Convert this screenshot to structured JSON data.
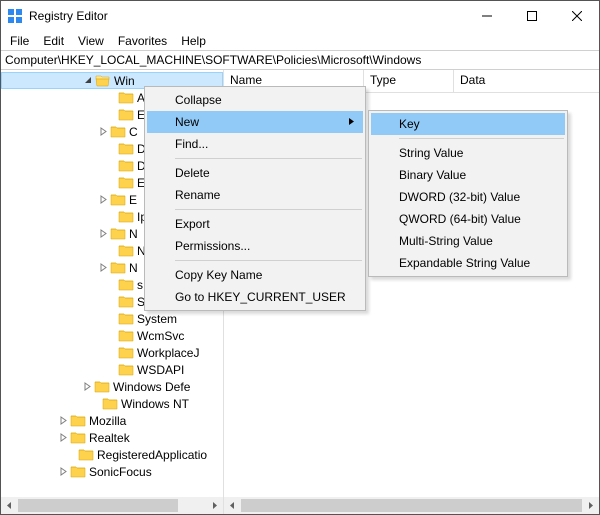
{
  "window": {
    "title": "Registry Editor"
  },
  "menubar": {
    "items": [
      "File",
      "Edit",
      "View",
      "Favorites",
      "Help"
    ]
  },
  "addressbar": {
    "path": "Computer\\HKEY_LOCAL_MACHINE\\SOFTWARE\\Policies\\Microsoft\\Windows"
  },
  "columns": {
    "name": "Name",
    "type": "Type",
    "data": "Data"
  },
  "tree": {
    "items": [
      {
        "indent": 80,
        "exp": "open",
        "label": "Win",
        "selected": true
      },
      {
        "indent": 104,
        "exp": "none",
        "label": "A"
      },
      {
        "indent": 104,
        "exp": "none",
        "label": "E"
      },
      {
        "indent": 96,
        "exp": "closed",
        "label": "C"
      },
      {
        "indent": 104,
        "exp": "none",
        "label": "D"
      },
      {
        "indent": 104,
        "exp": "none",
        "label": "D"
      },
      {
        "indent": 104,
        "exp": "none",
        "label": "E"
      },
      {
        "indent": 96,
        "exp": "closed",
        "label": "E"
      },
      {
        "indent": 104,
        "exp": "none",
        "label": "Ip"
      },
      {
        "indent": 96,
        "exp": "closed",
        "label": "N"
      },
      {
        "indent": 104,
        "exp": "none",
        "label": "N"
      },
      {
        "indent": 96,
        "exp": "closed",
        "label": "N"
      },
      {
        "indent": 104,
        "exp": "none",
        "label": "s"
      },
      {
        "indent": 104,
        "exp": "none",
        "label": "SettingSync"
      },
      {
        "indent": 104,
        "exp": "none",
        "label": "System"
      },
      {
        "indent": 104,
        "exp": "none",
        "label": "WcmSvc"
      },
      {
        "indent": 104,
        "exp": "none",
        "label": "WorkplaceJ"
      },
      {
        "indent": 104,
        "exp": "none",
        "label": "WSDAPI"
      },
      {
        "indent": 80,
        "exp": "closed",
        "label": "Windows Defe"
      },
      {
        "indent": 88,
        "exp": "none",
        "label": "Windows NT"
      },
      {
        "indent": 56,
        "exp": "closed",
        "label": "Mozilla"
      },
      {
        "indent": 56,
        "exp": "closed",
        "label": "Realtek"
      },
      {
        "indent": 64,
        "exp": "none",
        "label": "RegisteredApplicatio"
      },
      {
        "indent": 56,
        "exp": "closed",
        "label": "SonicFocus"
      }
    ]
  },
  "context_menu_main": {
    "items": [
      {
        "label": "Collapse",
        "type": "item"
      },
      {
        "label": "New",
        "type": "submenu",
        "highlight": true
      },
      {
        "label": "Find...",
        "type": "item"
      },
      {
        "type": "sep"
      },
      {
        "label": "Delete",
        "type": "item"
      },
      {
        "label": "Rename",
        "type": "item"
      },
      {
        "type": "sep"
      },
      {
        "label": "Export",
        "type": "item"
      },
      {
        "label": "Permissions...",
        "type": "item"
      },
      {
        "type": "sep"
      },
      {
        "label": "Copy Key Name",
        "type": "item"
      },
      {
        "label": "Go to HKEY_CURRENT_USER",
        "type": "item"
      }
    ]
  },
  "context_menu_sub": {
    "items": [
      {
        "label": "Key",
        "highlight": true
      },
      {
        "type": "sep"
      },
      {
        "label": "String Value"
      },
      {
        "label": "Binary Value"
      },
      {
        "label": "DWORD (32-bit) Value"
      },
      {
        "label": "QWORD (64-bit) Value"
      },
      {
        "label": "Multi-String Value"
      },
      {
        "label": "Expandable String Value"
      }
    ]
  }
}
